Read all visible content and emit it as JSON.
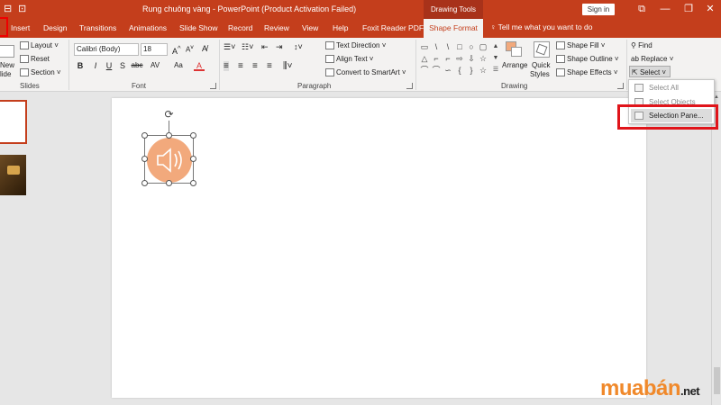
{
  "window": {
    "title": "Rung chuông vàng  -  PowerPoint (Product Activation Failed)",
    "context_tab_header": "Drawing Tools",
    "signin_label": "Sign in",
    "controls": {
      "minimize": "—",
      "restore": "❐",
      "close": "✕",
      "ribbon_display": "⧉"
    }
  },
  "tabs": [
    "Insert",
    "Design",
    "Transitions",
    "Animations",
    "Slide Show",
    "Record",
    "Review",
    "View",
    "Help",
    "Foxit Reader PDF"
  ],
  "active_tab": "Shape Format",
  "tell_me": "Tell me what you want to do",
  "ribbon": {
    "slides": {
      "new_slide": "New",
      "new_slide_2": "lide",
      "layout": "Layout",
      "reset": "Reset",
      "section": "Section",
      "label": "Slides"
    },
    "font": {
      "name": "Calibri (Body)",
      "size": "18",
      "label": "Font",
      "buttons": [
        "B",
        "I",
        "U",
        "S",
        "abc",
        "AV",
        "Aa",
        "A"
      ]
    },
    "paragraph": {
      "text_direction": "Text Direction",
      "align_text": "Align Text",
      "convert_smartart": "Convert to SmartArt",
      "label": "Paragraph"
    },
    "drawing": {
      "arrange": "Arrange",
      "quick_styles_1": "Quick",
      "quick_styles_2": "Styles",
      "shape_fill": "Shape Fill",
      "shape_outline": "Shape Outline",
      "shape_effects": "Shape Effects",
      "label": "Drawing"
    },
    "editing": {
      "find": "Find",
      "replace": "Replace",
      "select": "Select"
    }
  },
  "dropdown": {
    "items": [
      "Select All",
      "Select Objects",
      "Selection Pane..."
    ]
  },
  "watermark": {
    "brand": "muabán",
    "suffix": ".net"
  }
}
